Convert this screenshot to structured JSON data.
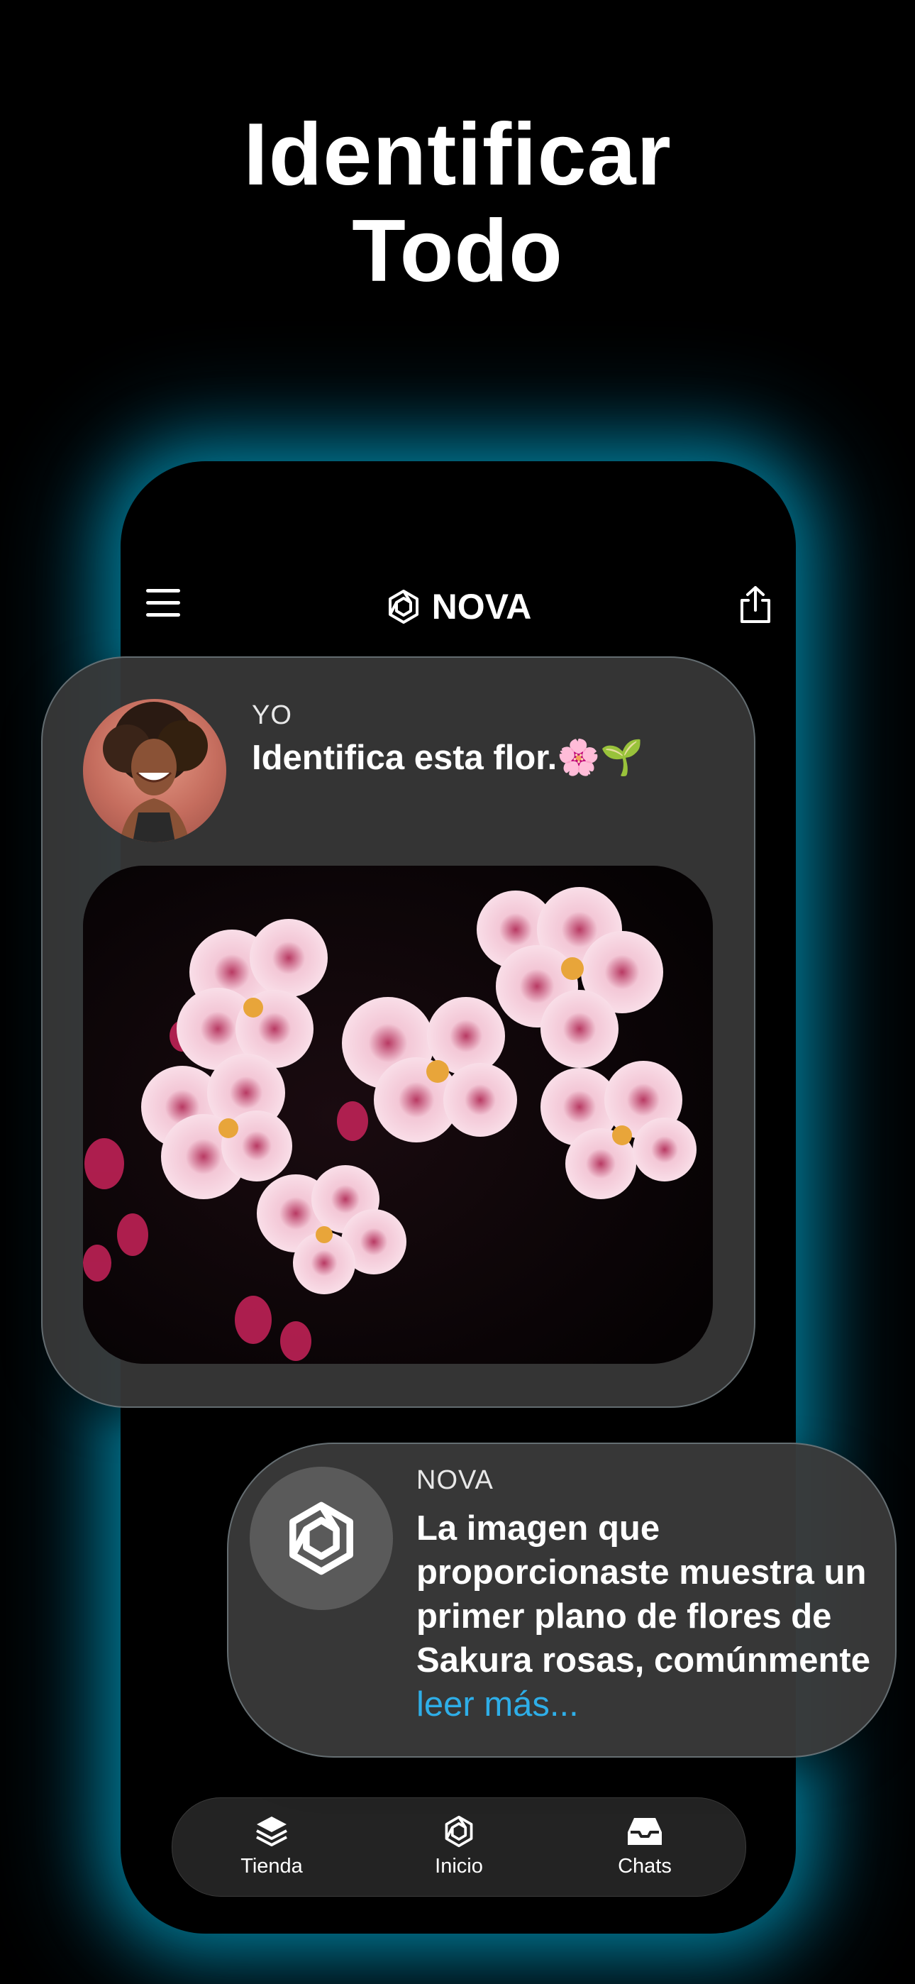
{
  "headline": {
    "line1": "Identificar",
    "line2": "Todo"
  },
  "app_bar": {
    "brand": "NOVA",
    "menu_icon": "hamburger-menu-icon",
    "share_icon": "share-icon",
    "logo_icon": "nova-logo-icon"
  },
  "user_message": {
    "sender": "YO",
    "text": "Identifica esta flor.🌸🌱",
    "image_subject": "sakura-flowers-photo"
  },
  "nova_reply": {
    "sender": "NOVA",
    "text": "La imagen que proporcionaste muestra un primer plano de flores de Sakura rosas, comúnmente",
    "read_more": "leer más..."
  },
  "bottom_nav": {
    "items": [
      {
        "label": "Tienda",
        "icon": "layers-icon"
      },
      {
        "label": "Inicio",
        "icon": "nova-logo-icon"
      },
      {
        "label": "Chats",
        "icon": "inbox-icon"
      }
    ]
  },
  "colors": {
    "background": "#000000",
    "glow": "#00bee6",
    "card": "#383838",
    "nav": "#232323",
    "link": "#2eaee8"
  }
}
